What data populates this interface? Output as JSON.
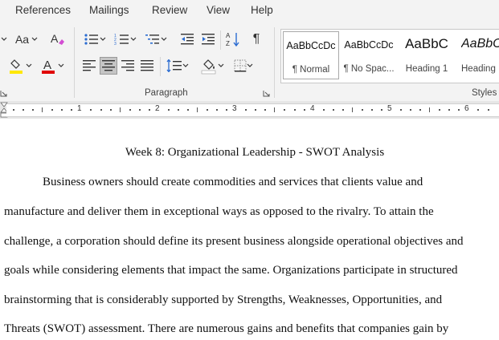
{
  "ribbon_tabs": [
    "References",
    "Mailings",
    "Review",
    "View",
    "Help"
  ],
  "ribbon": {
    "font_size_label": "Aa",
    "paragraph_label": "Paragraph",
    "styles_label": "Styles",
    "highlight_color": "#ffe800",
    "font_color": "#e00000"
  },
  "styles_gallery": [
    {
      "sample": "AaBbCcDc",
      "name": "¶ Normal",
      "selected": true
    },
    {
      "sample": "AaBbCcDc",
      "name": "¶ No Spac...",
      "selected": false
    },
    {
      "sample": "AaBbC",
      "name": "Heading 1",
      "selected": false
    },
    {
      "sample": "AaBbC",
      "name": "Heading",
      "selected": false
    }
  ],
  "ruler": {
    "numbers": [
      "1",
      "2",
      "3",
      "4",
      "5",
      "6"
    ]
  },
  "document": {
    "title": "Week 8: Organizational Leadership - SWOT Analysis",
    "lines": [
      "Business owners should create commodities and services that clients value and",
      "manufacture and deliver them in exceptional ways as opposed to the rivalry. To attain the",
      "challenge, a corporation should define its present business alongside operational objectives and",
      "goals while considering elements that impact the same. Organizations participate in structured",
      "brainstorming that is considerably supported by Strengths, Weaknesses, Opportunities, and",
      "Threats (SWOT) assessment. There are numerous gains and benefits that companies gain by"
    ]
  }
}
